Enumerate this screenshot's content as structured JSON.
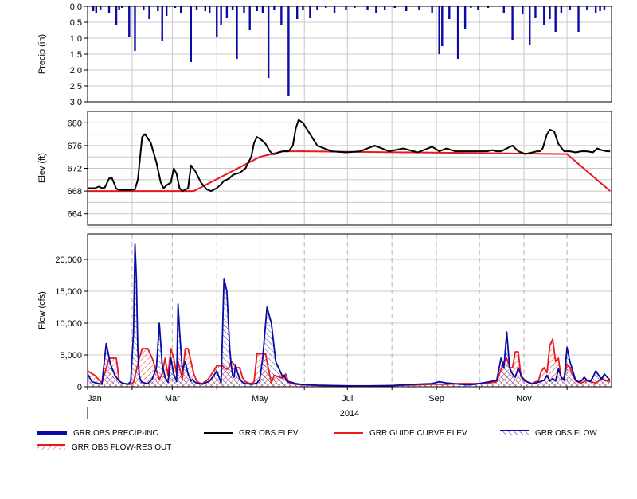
{
  "colors": {
    "precip": "#0a0aa6",
    "obs_elev": "#000000",
    "guide_curve": "#e8191e",
    "obs_flow": "#0a0aa6",
    "res_out": "#e8191e",
    "grid": "#c8c8c8"
  },
  "chart_data": [
    {
      "type": "bar",
      "ylabel": "Precip (in)",
      "ylim": [
        3.0,
        0.0
      ],
      "yticks": [
        "0.0",
        "0.5",
        "1.0",
        "1.5",
        "2.0",
        "2.5",
        "3.0"
      ],
      "inverted": true,
      "grid": true,
      "series": [
        {
          "name": "GRR OBS PRECIP-INC",
          "x_day": [
            4,
            6,
            9,
            15,
            20,
            22,
            24,
            29,
            33,
            39,
            43,
            49,
            52,
            55,
            61,
            65,
            72,
            76,
            82,
            85,
            90,
            93,
            97,
            101,
            104,
            109,
            113,
            118,
            122,
            126,
            130,
            135,
            140,
            146,
            150,
            155,
            160,
            166,
            172,
            180,
            186,
            195,
            201,
            207,
            214,
            222,
            231,
            240,
            245,
            247,
            252,
            258,
            263,
            267,
            272,
            279,
            290,
            296,
            303,
            308,
            312,
            318,
            322,
            326,
            330,
            336,
            342,
            348,
            354,
            357,
            360
          ],
          "values": [
            0.15,
            0.2,
            0.1,
            0.2,
            0.6,
            0.1,
            0.05,
            0.95,
            1.4,
            0.1,
            0.4,
            0.15,
            1.1,
            0.3,
            0.05,
            0.2,
            1.75,
            0.1,
            0.15,
            0.2,
            0.95,
            0.6,
            0.35,
            0.1,
            1.65,
            0.2,
            0.75,
            0.15,
            0.2,
            2.25,
            0.1,
            0.6,
            2.8,
            0.4,
            0.1,
            0.35,
            0.1,
            0.05,
            0.2,
            0.1,
            0.05,
            0.1,
            0.2,
            0.1,
            0.05,
            0.15,
            0.1,
            0.2,
            1.5,
            1.25,
            0.4,
            1.65,
            0.7,
            0.05,
            0.1,
            0.05,
            0.2,
            1.05,
            0.25,
            1.2,
            0.35,
            0.6,
            0.4,
            0.8,
            0.2,
            0.1,
            0.8,
            0.1,
            0.2,
            0.15,
            0.1
          ]
        }
      ]
    },
    {
      "type": "line",
      "ylabel": "Elev (ft)",
      "ylim": [
        662,
        682
      ],
      "yticks": [
        664,
        668,
        672,
        676,
        680
      ],
      "grid": true,
      "series": [
        {
          "name": "GRR OBS ELEV",
          "x_day": [
            0,
            5,
            8,
            10,
            12,
            15,
            17,
            20,
            22,
            25,
            30,
            33,
            35,
            37,
            38,
            40,
            44,
            48,
            51,
            53,
            55,
            58,
            60,
            62,
            64,
            66,
            70,
            72,
            75,
            79,
            83,
            86,
            90,
            93,
            95,
            97,
            99,
            101,
            103,
            106,
            110,
            114,
            116,
            118,
            120,
            122,
            124,
            127,
            129,
            131,
            133,
            136,
            140,
            143,
            145,
            147,
            150,
            160,
            170,
            180,
            190,
            200,
            210,
            220,
            230,
            240,
            245,
            250,
            256,
            262,
            266,
            270,
            278,
            282,
            285,
            288,
            292,
            296,
            300,
            305,
            308,
            310,
            313,
            315,
            317,
            320,
            322,
            325,
            328,
            332,
            336,
            340,
            344,
            348,
            352,
            355,
            358,
            362,
            364
          ],
          "values": [
            668.5,
            668.5,
            668.8,
            668.5,
            668.6,
            670.2,
            670.3,
            668.4,
            668.2,
            668.2,
            668.2,
            668.3,
            670,
            675,
            677.5,
            678,
            676.5,
            673,
            669.5,
            668.5,
            669,
            669.5,
            672,
            671,
            668.5,
            668,
            668.5,
            672.5,
            671.5,
            669.5,
            668.3,
            668,
            668.5,
            669.2,
            669.8,
            670,
            670.3,
            670.8,
            671,
            671.2,
            672,
            674,
            676.5,
            677.5,
            677.2,
            676.8,
            676.3,
            675,
            674.5,
            674.5,
            674.8,
            675,
            675,
            676,
            679,
            680.5,
            680,
            676,
            675,
            674.8,
            675,
            676,
            675,
            675.5,
            674.8,
            675.8,
            675,
            675.5,
            675,
            675,
            675,
            675,
            675,
            675.2,
            675,
            675,
            675.5,
            676,
            675,
            674.5,
            674.7,
            674.8,
            675,
            675,
            675.5,
            678,
            678.8,
            678.5,
            676.3,
            675,
            675,
            674.8,
            675,
            675,
            674.8,
            675.5,
            675.2,
            675,
            675
          ]
        },
        {
          "name": "GRR GUIDE CURVE ELEV",
          "x_day": [
            0,
            74,
            120,
            136,
            151,
            334,
            364
          ],
          "values": [
            668,
            668,
            674,
            675,
            675,
            674.5,
            668
          ]
        }
      ]
    },
    {
      "type": "line",
      "ylabel": "Flow (cfs)",
      "ylim": [
        0,
        24000
      ],
      "yticks": [
        "0",
        "5,000",
        "10,000",
        "15,000",
        "20,000"
      ],
      "xticks": [
        "Jan",
        "Mar",
        "May",
        "Jul",
        "Sep",
        "Nov"
      ],
      "xlabel": "2014",
      "grid": true,
      "series": [
        {
          "name": "GRR OBS FLOW",
          "x_day": [
            0,
            3,
            6,
            10,
            13,
            16,
            19,
            22,
            24,
            26,
            28,
            30,
            32,
            33,
            34,
            35,
            36,
            37,
            38,
            40,
            42,
            45,
            48,
            50,
            52,
            54,
            56,
            58,
            60,
            62,
            63,
            64,
            66,
            68,
            70,
            72,
            73,
            74,
            75,
            76,
            78,
            80,
            82,
            85,
            88,
            90,
            93,
            95,
            97,
            99,
            100,
            101,
            102,
            103,
            104,
            106,
            108,
            110,
            112,
            115,
            118,
            120,
            122,
            125,
            128,
            131,
            134,
            136,
            137,
            138,
            139,
            140,
            142,
            145,
            148,
            150,
            155,
            160,
            170,
            180,
            190,
            200,
            210,
            220,
            230,
            240,
            245,
            250,
            255,
            260,
            265,
            270,
            275,
            280,
            285,
            288,
            290,
            292,
            294,
            296,
            298,
            300,
            302,
            304,
            306,
            308,
            310,
            312,
            315,
            318,
            320,
            322,
            324,
            326,
            328,
            330,
            332,
            334,
            336,
            338,
            340,
            342,
            344,
            346,
            348,
            350,
            352,
            354,
            356,
            358,
            360,
            362,
            364
          ],
          "values": [
            2000,
            800,
            600,
            400,
            6800,
            3500,
            1800,
            900,
            600,
            500,
            400,
            800,
            8500,
            22500,
            17000,
            5500,
            1800,
            1000,
            700,
            600,
            500,
            1200,
            3000,
            10000,
            3500,
            1500,
            700,
            4500,
            2000,
            800,
            13000,
            9000,
            2500,
            4000,
            2000,
            900,
            1200,
            900,
            700,
            600,
            500,
            400,
            600,
            900,
            1800,
            2500,
            600,
            17000,
            15000,
            6000,
            3500,
            1800,
            1500,
            3500,
            2500,
            1200,
            700,
            500,
            450,
            400,
            600,
            1200,
            4500,
            12500,
            10000,
            4000,
            2500,
            1500,
            1800,
            1200,
            900,
            800,
            700,
            500,
            400,
            350,
            300,
            250,
            200,
            150,
            100,
            150,
            150,
            300,
            400,
            500,
            800,
            600,
            500,
            400,
            300,
            400,
            600,
            800,
            1000,
            4500,
            3000,
            8600,
            3000,
            2000,
            1500,
            3000,
            1800,
            1000,
            800,
            600,
            500,
            600,
            800,
            1000,
            1800,
            900,
            1300,
            900,
            2800,
            1500,
            1000,
            6200,
            4000,
            2500,
            1000,
            800,
            900,
            1500,
            1000,
            800,
            1500,
            2500,
            1800,
            1200,
            2000,
            1500,
            1000,
            1600,
            800
          ]
        },
        {
          "name": "GRR OBS FLOW-RES OUT",
          "x_day": [
            0,
            5,
            10,
            15,
            20,
            22,
            24,
            26,
            28,
            30,
            32,
            36,
            38,
            40,
            42,
            45,
            48,
            50,
            52,
            54,
            56,
            58,
            60,
            62,
            63,
            66,
            68,
            70,
            74,
            76,
            78,
            80,
            84,
            88,
            90,
            92,
            94,
            96,
            98,
            100,
            104,
            106,
            108,
            110,
            112,
            114,
            116,
            118,
            120,
            122,
            124,
            126,
            128,
            130,
            134,
            136,
            138,
            140,
            142,
            145,
            150,
            160,
            170,
            180,
            190,
            200,
            210,
            220,
            230,
            240,
            250,
            260,
            270,
            280,
            285,
            290,
            292,
            294,
            296,
            298,
            300,
            302,
            304,
            306,
            308,
            310,
            312,
            314,
            316,
            318,
            320,
            322,
            324,
            326,
            328,
            330,
            332,
            334,
            336,
            338,
            340,
            342,
            344,
            346,
            348,
            350,
            352,
            354,
            356,
            358,
            360,
            362,
            364
          ],
          "values": [
            2500,
            1800,
            600,
            4500,
            4500,
            900,
            600,
            500,
            400,
            400,
            700,
            4500,
            6000,
            6000,
            6000,
            4500,
            2500,
            1200,
            2000,
            4500,
            1800,
            6000,
            4500,
            2000,
            4000,
            1200,
            6000,
            6000,
            2000,
            900,
            600,
            500,
            1200,
            2500,
            3300,
            3300,
            3300,
            2800,
            2800,
            4000,
            3000,
            3000,
            1400,
            800,
            600,
            500,
            800,
            5200,
            5200,
            5200,
            5200,
            2800,
            600,
            1800,
            1500,
            1300,
            2000,
            700,
            500,
            400,
            300,
            200,
            150,
            150,
            150,
            150,
            200,
            250,
            300,
            400,
            400,
            500,
            500,
            600,
            800,
            4000,
            4500,
            3000,
            3000,
            5500,
            5500,
            1500,
            1200,
            800,
            600,
            500,
            800,
            900,
            2400,
            3000,
            2200,
            6500,
            7500,
            4000,
            4500,
            1200,
            1500,
            3500,
            3000,
            1800,
            1000,
            700,
            600,
            800,
            1000,
            900,
            700,
            600,
            900,
            1400,
            1000,
            900,
            800
          ]
        }
      ]
    }
  ],
  "legend": {
    "precip": "GRR OBS PRECIP-INC",
    "obs_elev": "GRR OBS ELEV",
    "guide_curve": "GRR GUIDE CURVE ELEV",
    "obs_flow": "GRR OBS FLOW",
    "res_out": "GRR OBS FLOW-RES OUT"
  }
}
